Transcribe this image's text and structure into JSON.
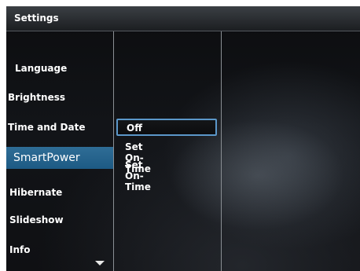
{
  "window": {
    "title": "Settings"
  },
  "sidebar": {
    "items": [
      {
        "label": "Language"
      },
      {
        "label": "Brightness"
      },
      {
        "label": "Time and Date"
      },
      {
        "label": "SmartPower",
        "selected": true
      },
      {
        "label": "Hibernate"
      },
      {
        "label": "Slideshow"
      },
      {
        "label": "Info"
      }
    ],
    "scroll_icon": "chevron-down-icon"
  },
  "submenu": {
    "options": [
      {
        "label": "Off",
        "focused": true
      },
      {
        "label": "Set On-Time"
      },
      {
        "label": "Set On-Time"
      }
    ]
  },
  "colors": {
    "selection": "#1d5a84",
    "focus_border": "#5b97c9",
    "background": "#121418"
  }
}
